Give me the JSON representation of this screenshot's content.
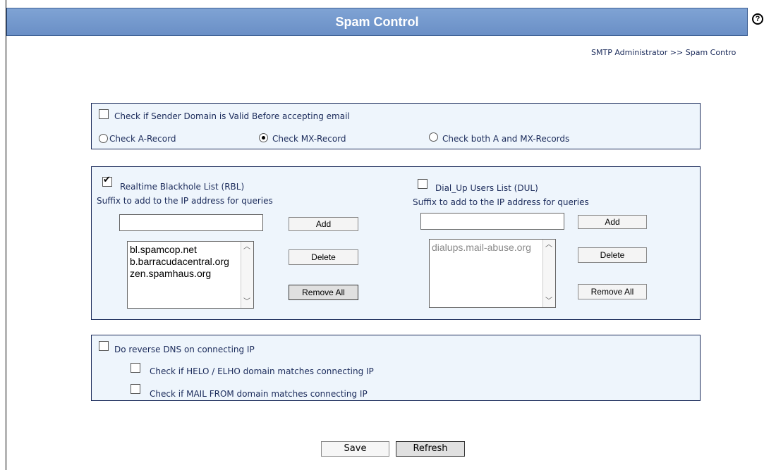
{
  "header": {
    "title": "Spam Control",
    "help_icon": "?"
  },
  "breadcrumb": "SMTP Administrator >> Spam Contro",
  "sender_domain": {
    "check_label": "Check if Sender Domain is Valid Before accepting email",
    "checked": false,
    "options": [
      {
        "label": "Check A-Record",
        "selected": false
      },
      {
        "label": "Check MX-Record",
        "selected": true
      },
      {
        "label": "Check both A and MX-Records",
        "selected": false
      }
    ]
  },
  "rbl": {
    "label": "Realtime Blackhole List (RBL)",
    "checked": true,
    "suffix_label": "Suffix to add to the IP address for queries",
    "input_value": "",
    "add_label": "Add",
    "delete_label": "Delete",
    "remove_all_label": "Remove All",
    "items": [
      "bl.spamcop.net",
      "b.barracudacentral.org",
      "zen.spamhaus.org"
    ]
  },
  "dul": {
    "label": "Dial_Up Users List (DUL)",
    "checked": false,
    "suffix_label": "Suffix to add to the IP address for queries",
    "input_value": "",
    "add_label": "Add",
    "delete_label": "Delete",
    "remove_all_label": "Remove All",
    "items": [
      "dialups.mail-abuse.org"
    ]
  },
  "reverse_dns": {
    "label": "Do reverse DNS on connecting IP",
    "checked": false,
    "helo_label": "Check if HELO / ELHO domain matches connecting IP",
    "helo_checked": false,
    "mailfrom_label": "Check if MAIL FROM domain matches connecting IP",
    "mailfrom_checked": false
  },
  "footer": {
    "save_label": "Save",
    "refresh_label": "Refresh"
  }
}
